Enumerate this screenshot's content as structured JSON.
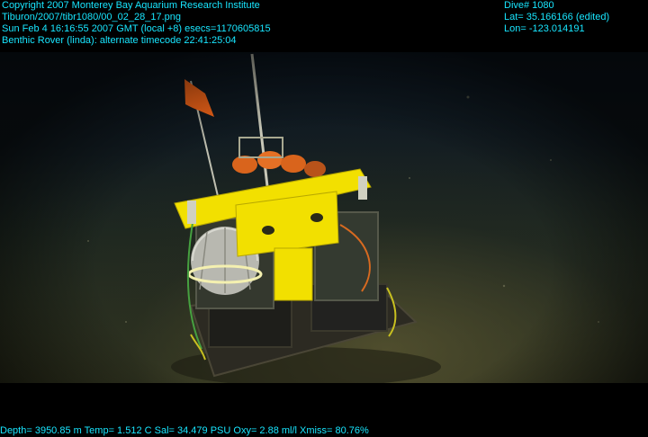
{
  "overlay": {
    "copyright": "Copyright 2007 Monterey Bay Aquarium Research Institute",
    "file": "Tiburon/2007/tibr1080/00_02_28_17.png",
    "datetime": "Sun Feb  4 16:16:55 2007 GMT (local +8)  esecs=1170605815",
    "rover_line": "Benthic Rover (linda): alternate timecode 22:41:25:04",
    "dive": "Dive# 1080",
    "lat": "Lat= 35.166166 (edited)",
    "lon": "Lon= -123.014191",
    "sensors": "Depth= 3950.85 m  Temp= 1.512 C  Sal= 34.479 PSU  Oxy= 2.88 ml/l  Xmiss= 80.76%"
  },
  "colors": {
    "overlay_text": "#18e6ff",
    "frame_background": "#000000",
    "rover_yellow": "#f2e000",
    "flag_orange": "#ff6a1a"
  }
}
